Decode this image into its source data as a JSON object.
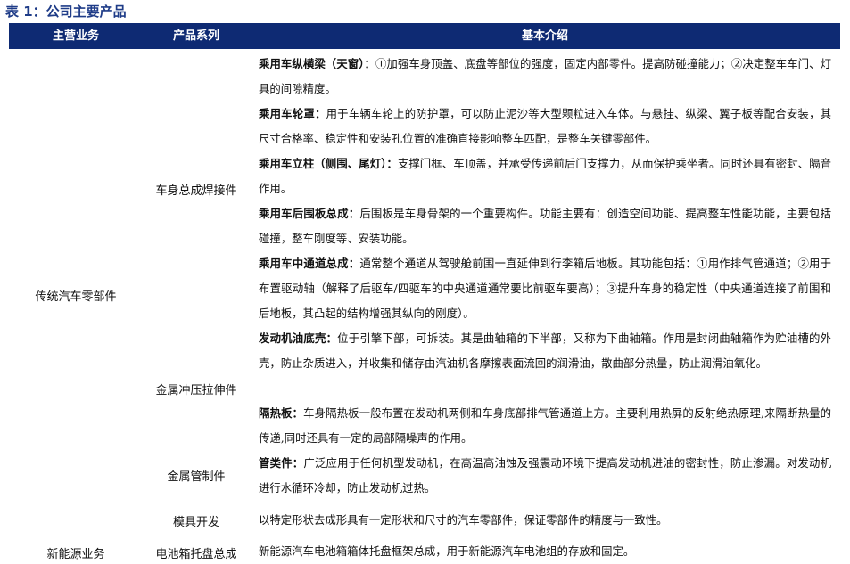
{
  "caption": "表 1：公司主要产品",
  "headers": {
    "business": "主营业务",
    "series": "产品系列",
    "intro": "基本介绍"
  },
  "business": {
    "traditional": "传统汽车零部件",
    "new_energy": "新能源业务"
  },
  "series": {
    "body_weld": "车身总成焊接件",
    "metal_stamp": "金属冲压拉伸件",
    "metal_pipe": "金属管制件",
    "mold": "模具开发",
    "battery_tray": "电池箱托盘总成"
  },
  "items": [
    {
      "title": "乘用车纵横梁（天窗）：",
      "text": "①加强车身顶盖、底盘等部位的强度，固定内部零件。提高防碰撞能力；②决定整车车门、灯具的间隙精度。"
    },
    {
      "title": "乘用车轮罩：",
      "text": "用于车辆车轮上的防护罩，可以防止泥沙等大型颗粒进入车体。与悬挂、纵梁、翼子板等配合安装，其尺寸合格率、稳定性和安装孔位置的准确直接影响整车匹配，是整车关键零部件。"
    },
    {
      "title": "乘用车立柱（侧围、尾灯）：",
      "text": "支撑门框、车顶盖，并承受传递前后门支撑力，从而保护乘坐者。同时还具有密封、隔音作用。"
    },
    {
      "title": "乘用车后围板总成：",
      "text": "后围板是车身骨架的一个重要构件。功能主要有：创造空间功能、提高整车性能功能，主要包括碰撞，整车刚度等、安装功能。"
    },
    {
      "title": "乘用车中通道总成：",
      "text": "通常整个通道从驾驶舱前围一直延伸到行李箱后地板。其功能包括：①用作排气管通道；②用于布置驱动轴（解释了后驱车/四驱车的中央通道通常要比前驱车要高）；③提升车身的稳定性（中央通道连接了前围和后地板，其凸起的结构增强其纵向的刚度）。"
    },
    {
      "title": "发动机油底壳：",
      "text": "位于引擎下部，可拆装。其是曲轴箱的下半部，又称为下曲轴箱。作用是封闭曲轴箱作为贮油槽的外壳，防止杂质进入，并收集和储存由汽油机各摩擦表面流回的润滑油，散曲部分热量，防止润滑油氧化。"
    },
    {
      "title": "隔热板：",
      "text": "车身隔热板一般布置在发动机两侧和车身底部排气管通道上方。主要利用热屏的反射绝热原理,来隔断热量的传递,同时还具有一定的局部隔噪声的作用。"
    },
    {
      "title": "管类件：",
      "text": "广泛应用于任何机型发动机，在高温高油蚀及强震动环境下提高发动机进油的密封性，防止渗漏。对发动机进行水循环冷却，防止发动机过热。"
    },
    {
      "title": "",
      "text": "以特定形状去成形具有一定形状和尺寸的汽车零部件，保证零部件的精度与一致性。"
    },
    {
      "title": "",
      "text": "新能源汽车电池箱箱体托盘框架总成，用于新能源汽车电池组的存放和固定。"
    }
  ]
}
